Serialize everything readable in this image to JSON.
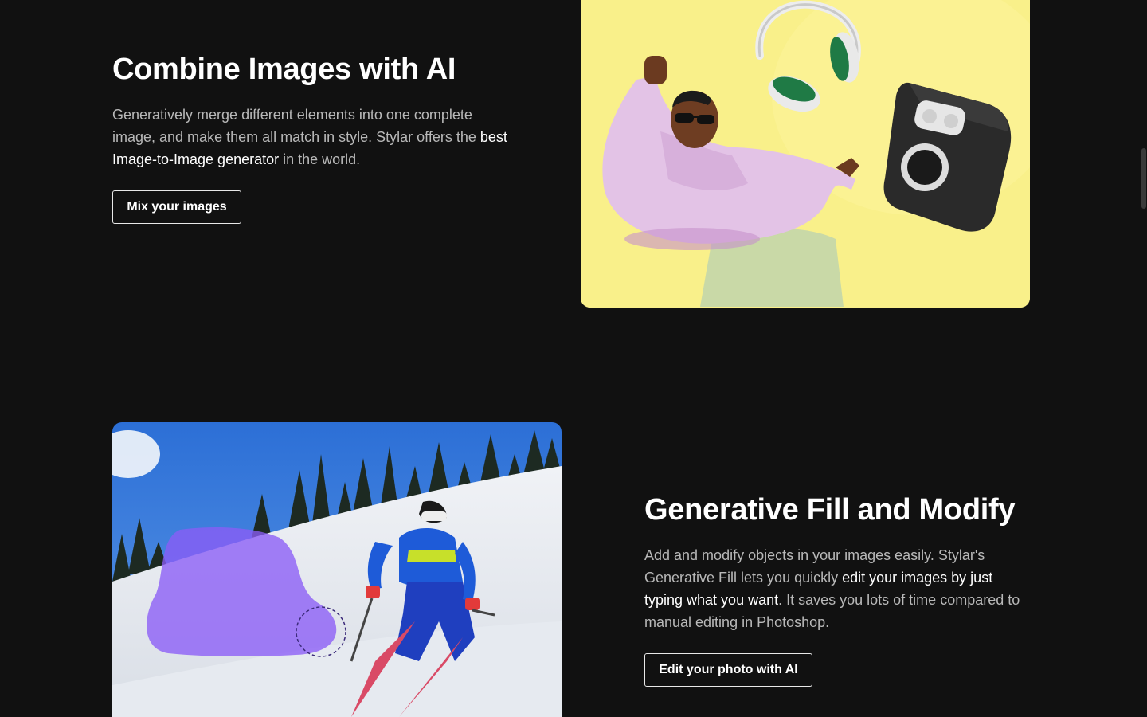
{
  "sections": [
    {
      "title": "Combine Images with AI",
      "description": {
        "part1": "Generatively merge different elements into one complete image, and make them all match in style. Stylar offers the ",
        "highlight": "best Image-to-Image generator",
        "part2": " in the world."
      },
      "cta_label": "Mix your images",
      "image": {
        "subject": "3D character in pink hoodie and sunglasses dancing with floating headphones and speaker",
        "background_color": "#f9f08a"
      }
    },
    {
      "title": "Generative Fill and Modify",
      "description": {
        "part1": "Add and modify objects in your images easily. Stylar's Generative Fill lets you quickly ",
        "highlight": "edit your images by just typing what you want",
        "part2": ". It saves you lots of time compared to manual editing in Photoshop."
      },
      "cta_label": "Edit your photo with AI",
      "image": {
        "subject": "Skier on a snowy slope with a purple selection mask over a second skier",
        "mask_color": "#8b5cf6"
      }
    }
  ],
  "colors": {
    "background": "#111111",
    "text_primary": "#ffffff",
    "text_secondary": "#b8b8b8"
  }
}
